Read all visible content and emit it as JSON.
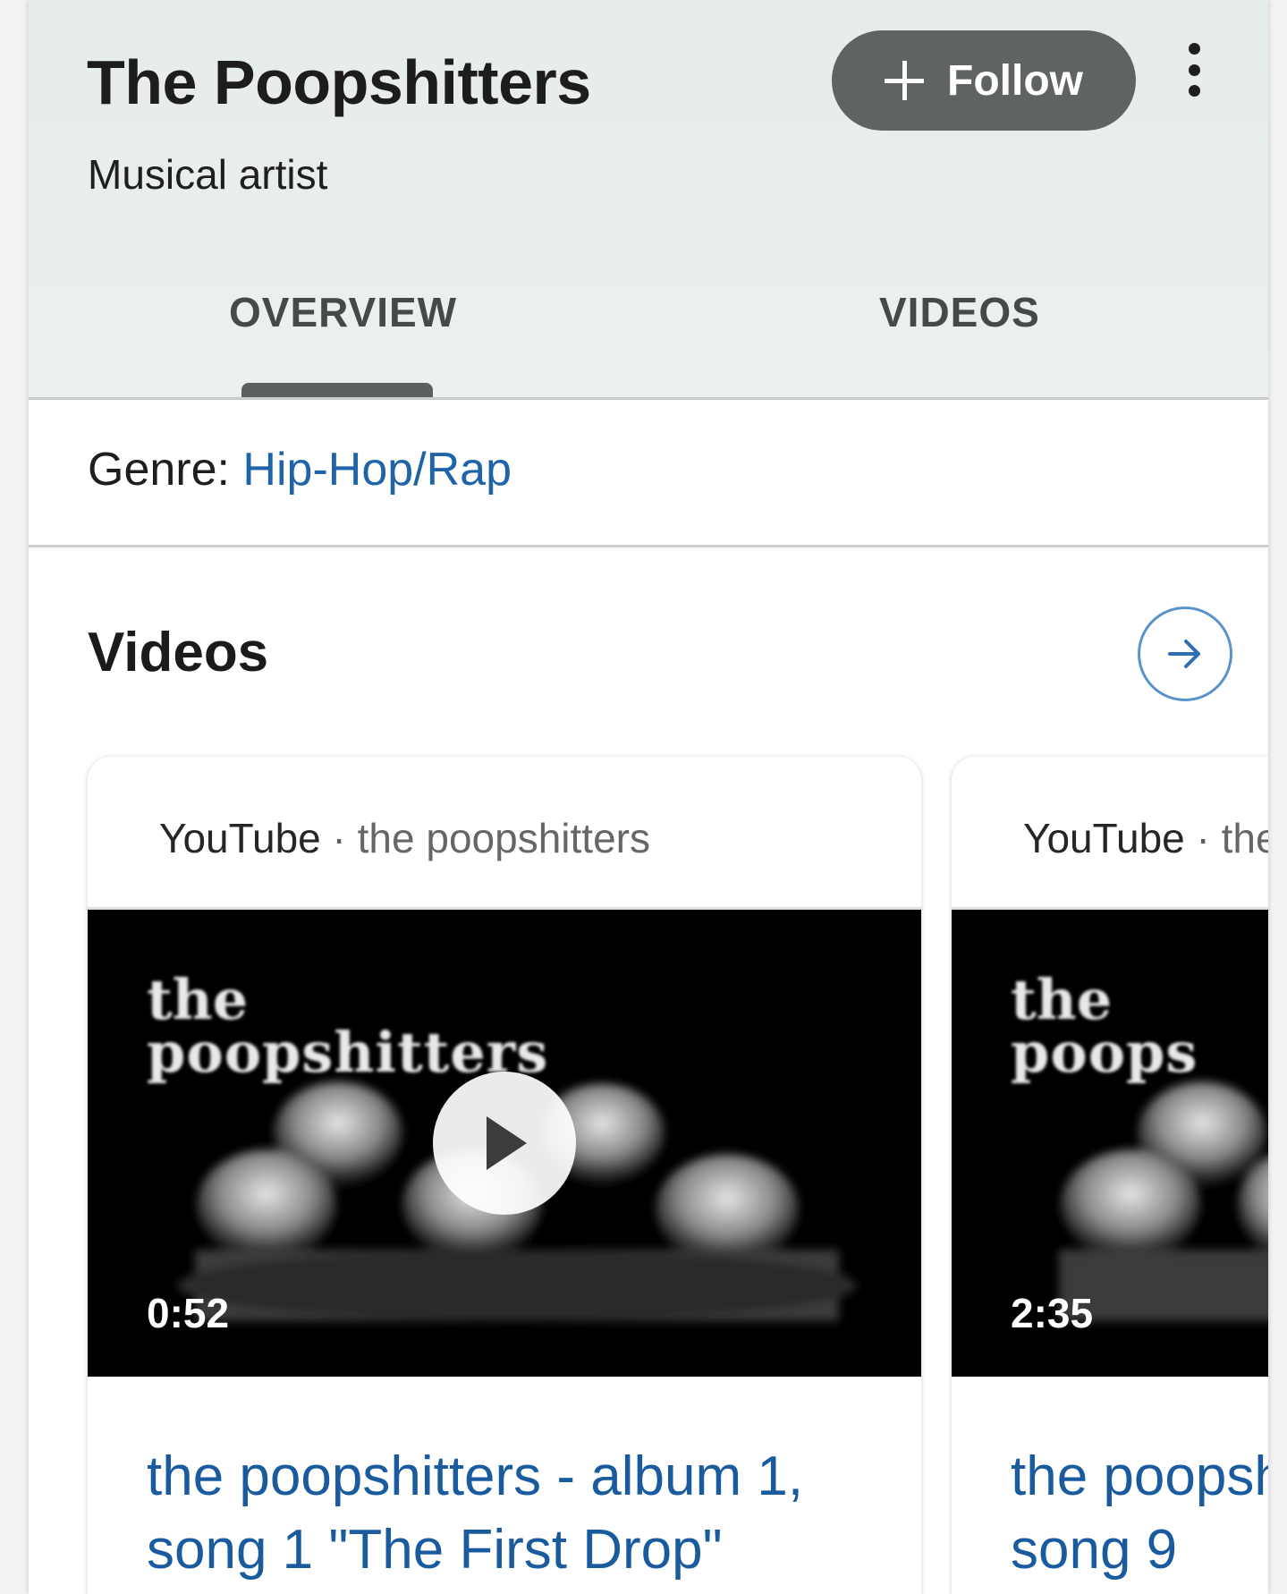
{
  "header": {
    "title": "The Poopshitters",
    "subtitle": "Musical artist",
    "follow_label": "Follow",
    "more_icon": "more-vert-icon"
  },
  "tabs": [
    {
      "label": "OVERVIEW",
      "active": true
    },
    {
      "label": "VIDEOS",
      "active": false
    }
  ],
  "genre": {
    "label": "Genre: ",
    "value": "Hip-Hop/Rap"
  },
  "videos_section": {
    "title": "Videos",
    "arrow_icon": "arrow-right-icon",
    "items": [
      {
        "source": "YouTube",
        "separator": " · ",
        "channel": "the poopshitters",
        "thumb_line1": "the",
        "thumb_line2": "poopshitters",
        "duration": "0:52",
        "title": "the poopshitters - album 1, song 1 \"The First Drop\""
      },
      {
        "source": "YouTube",
        "separator": " · ",
        "channel": "the",
        "thumb_line1": "the",
        "thumb_line2": "poops",
        "duration": "2:35",
        "title": "the poopsh song 9"
      }
    ]
  },
  "colors": {
    "link": "#1f63a8",
    "follow_bg": "#5f6363",
    "header_bg": "#e8ecec"
  }
}
